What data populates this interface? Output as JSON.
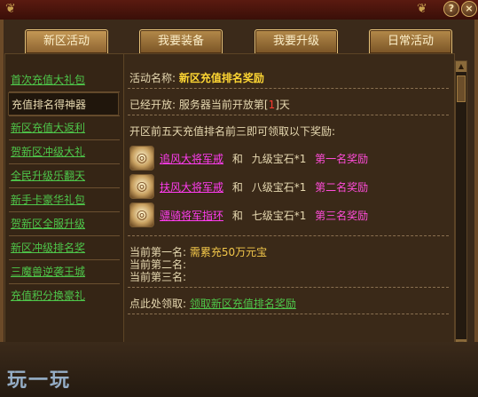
{
  "tabs": [
    {
      "label": "新区活动"
    },
    {
      "label": "我要装备"
    },
    {
      "label": "我要升级"
    },
    {
      "label": "日常活动"
    }
  ],
  "sidebar": {
    "items": [
      {
        "label": "首次充值大礼包"
      },
      {
        "label": "充值排名得神器"
      },
      {
        "label": "新区充值大返利"
      },
      {
        "label": "贺新区冲级大礼"
      },
      {
        "label": "全民升级乐翻天"
      },
      {
        "label": "新手卡豪华礼包"
      },
      {
        "label": "贺新区全服升级"
      },
      {
        "label": "新区冲级排名奖"
      },
      {
        "label": "三魔兽逆袭王城"
      },
      {
        "label": "充值积分换豪礼"
      }
    ]
  },
  "detail": {
    "name_label": "活动名称:",
    "name_value": "新区充值排名奖励",
    "open_label": "已经开放:",
    "open_prefix": "服务器当前开放第[",
    "open_day": "1",
    "open_suffix": "]天",
    "rule_text": "开区前五天充值排名前三即可领取以下奖励:",
    "rewards": [
      {
        "item": "追风大将军戒",
        "and": "和",
        "gem": "九级宝石*1",
        "rank": "第一名奖励"
      },
      {
        "item": "扶风大将军戒",
        "and": "和",
        "gem": "八级宝石*1",
        "rank": "第二名奖励"
      },
      {
        "item": "骠骑将军指环",
        "and": "和",
        "gem": "七级宝石*1",
        "rank": "第三名奖励"
      }
    ],
    "current": [
      {
        "label": "当前第一名:",
        "value": "需累充50万元宝"
      },
      {
        "label": "当前第二名:",
        "value": ""
      },
      {
        "label": "当前第三名:",
        "value": ""
      }
    ],
    "claim_label": "点此处领取:",
    "claim_link": "领取新区充值排名奖励"
  },
  "window": {
    "help": "?",
    "close": "×"
  },
  "watermark": "玩一玩"
}
